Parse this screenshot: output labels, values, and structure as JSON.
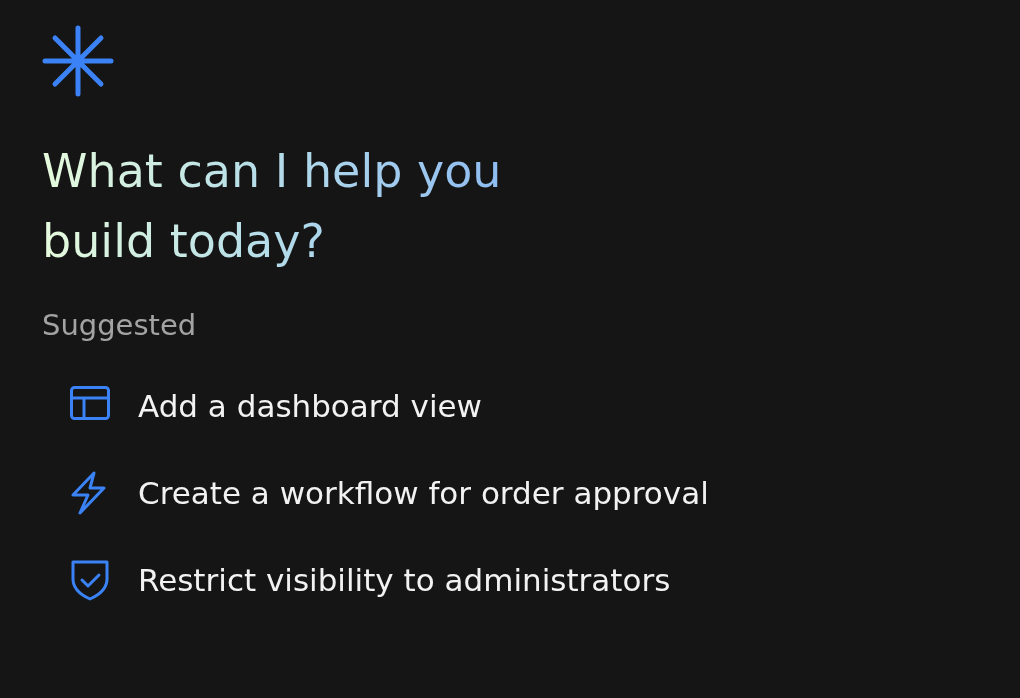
{
  "heading": {
    "lines": [
      "What can I help you",
      "build today?"
    ]
  },
  "suggested": {
    "title": "Suggested",
    "items": [
      {
        "kind": "layout",
        "label": "Add a dashboard view"
      },
      {
        "kind": "bolt",
        "label": "Create a workflow for order approval"
      },
      {
        "kind": "shield",
        "label": "Restrict visibility to administrators"
      }
    ]
  }
}
